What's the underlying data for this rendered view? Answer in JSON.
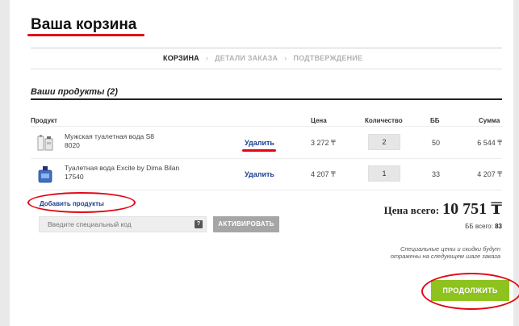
{
  "header": {
    "title": "Ваша корзина"
  },
  "steps": [
    {
      "label": "КОРЗИНА",
      "active": true
    },
    {
      "label": "ДЕТАЛИ ЗАКАЗА",
      "active": false
    },
    {
      "label": "ПОДТВЕРЖДЕНИЕ",
      "active": false
    }
  ],
  "steps_separator": "›",
  "cart": {
    "section_title": "Ваши продукты (2)",
    "columns": {
      "product": "Продукт",
      "price": "Цена",
      "quantity": "Количество",
      "bb": "ББ",
      "sum": "Сумма"
    },
    "items": [
      {
        "name": "Мужская туалетная вода S8",
        "code": "8020",
        "delete_label": "Удалить",
        "price": "3 272 ₸",
        "quantity": "2",
        "bb": "50",
        "sum": "6 544 ₸"
      },
      {
        "name": "Туалетная вода Excite by Dima Bilan",
        "code": "17540",
        "delete_label": "Удалить",
        "price": "4 207 ₸",
        "quantity": "1",
        "bb": "33",
        "sum": "4 207 ₸"
      }
    ],
    "add_products_label": "Добавить продукты",
    "promo": {
      "placeholder": "Введите специальный код",
      "help_icon": "?",
      "activate_label": "АКТИВИРОВАТЬ"
    },
    "total_label": "Цена всего:",
    "total_value": "10 751 ₸",
    "bb_total_label": "ББ всего:",
    "bb_total_value": "83",
    "note": "Специальные цены и скидки будут отражены на следующем шаге заказа",
    "continue_label": "ПРОДОЛЖИТЬ"
  },
  "icons": {
    "product_1": "perfume-bottle-icon",
    "product_2": "perfume-bottle-icon"
  },
  "colors": {
    "accent_red": "#e30613",
    "link_blue": "#1b3f8f",
    "continue_green": "#8dc21f",
    "activate_gray": "#a6a6a6"
  }
}
